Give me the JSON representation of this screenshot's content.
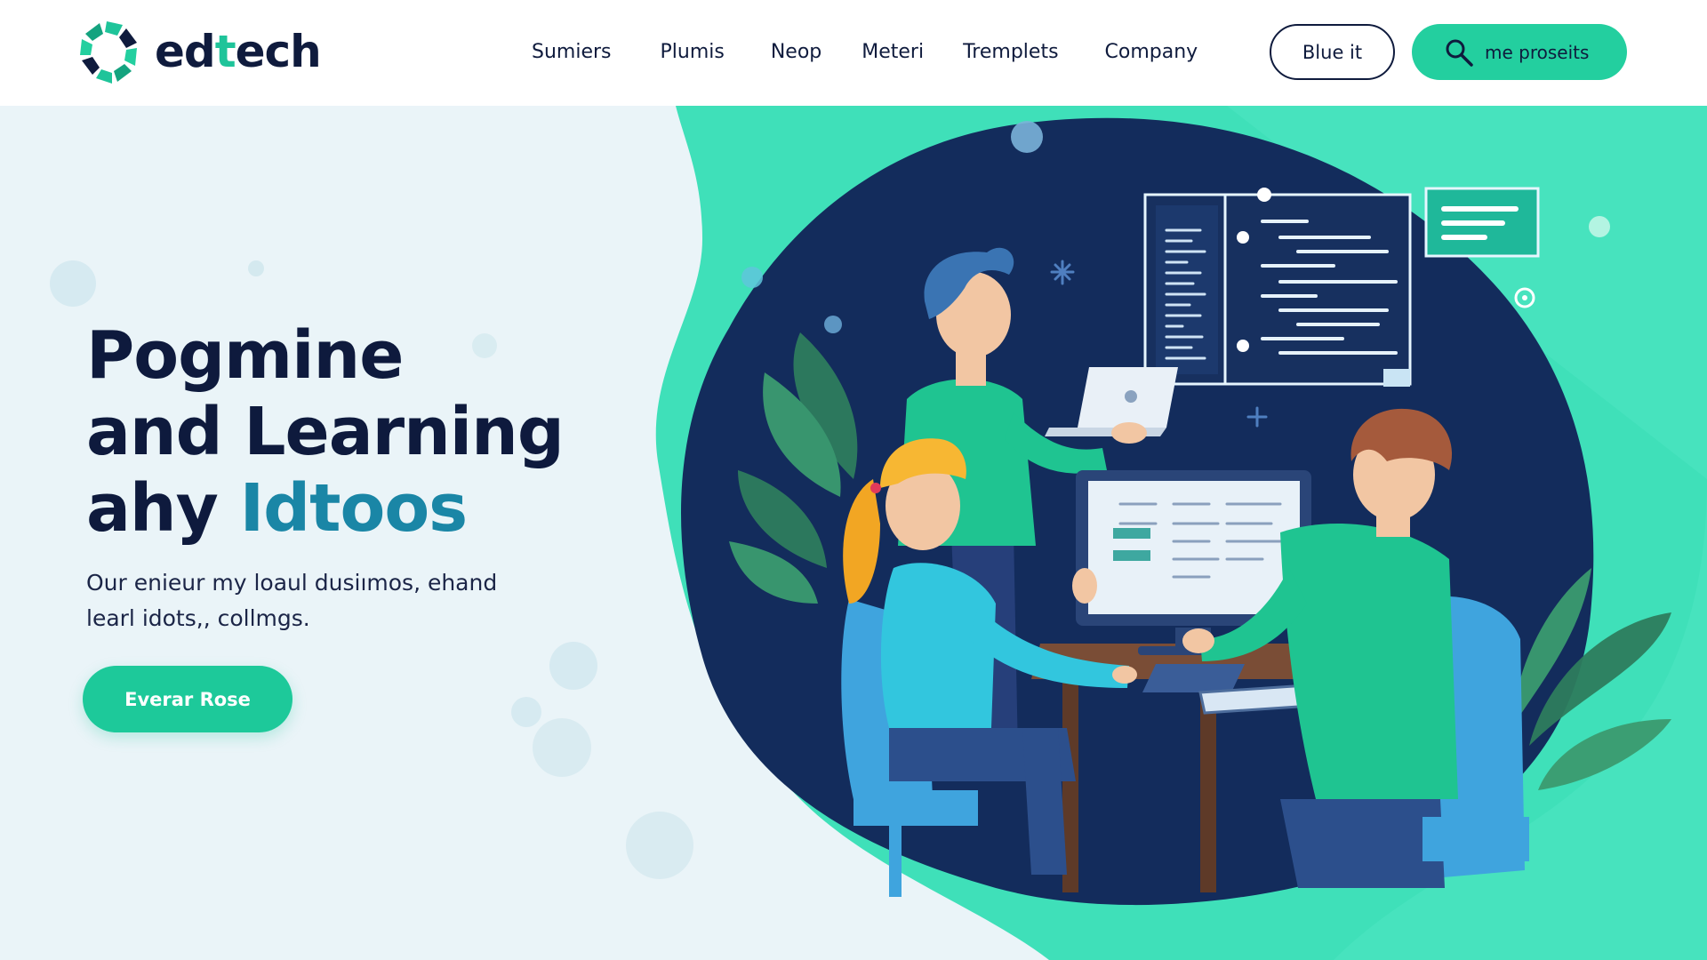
{
  "brand": {
    "name_part1": "ed",
    "name_accent": "t",
    "name_part2": "ech",
    "logo_icon": "recycle-ring-logo-icon"
  },
  "nav": {
    "items": [
      "Sumiers",
      "Plumis",
      "Neop",
      "Meteri",
      "Tremplets",
      "Company"
    ]
  },
  "header_actions": {
    "outline_button_label": "Blue it",
    "search_icon": "search-icon",
    "search_label": "me proseits"
  },
  "hero": {
    "title_line1": "Pogmine",
    "title_line2": "and Learning",
    "title_line3_a": "ahy ",
    "title_line3_highlight": "Idtoos",
    "subtitle_line1": "Our enieur my loaul dusiımos, ehand",
    "subtitle_line2": "learl idots,, collmgs.",
    "cta_label": "Everar Rose"
  },
  "colors": {
    "navy": "#0f1b3d",
    "brand_green": "#23cf9f",
    "heading_highlight": "#1a86a6",
    "hero_left_bg": "#eaf4f8",
    "blob_navy": "#132c5c"
  }
}
